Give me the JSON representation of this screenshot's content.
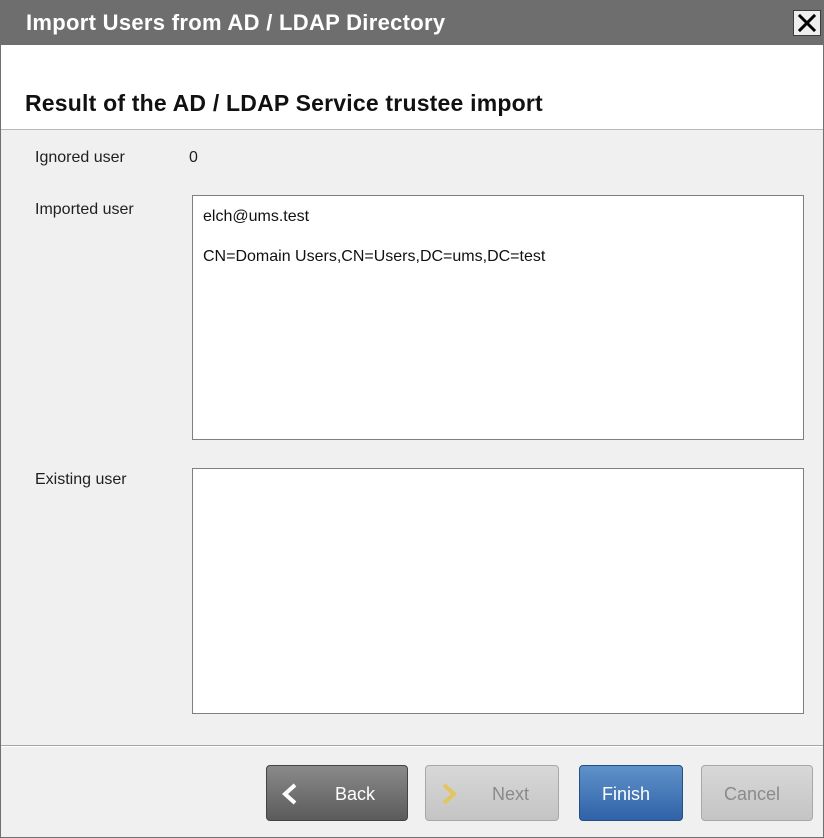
{
  "window": {
    "title": "Import Users from AD / LDAP Directory",
    "close_icon": "close-icon"
  },
  "header": {
    "title": "Result of the AD / LDAP Service trustee import"
  },
  "form": {
    "ignored_label": "Ignored user",
    "ignored_value": "0",
    "imported_label": "Imported user",
    "imported_items": [
      "elch@ums.test",
      "CN=Domain Users,CN=Users,DC=ums,DC=test"
    ],
    "existing_label": "Existing user",
    "existing_items": []
  },
  "footer": {
    "back_label": "Back",
    "next_label": "Next",
    "finish_label": "Finish",
    "cancel_label": "Cancel"
  },
  "colors": {
    "titlebar": "#6e6e6e",
    "accent_finish": "#2f62a7"
  }
}
